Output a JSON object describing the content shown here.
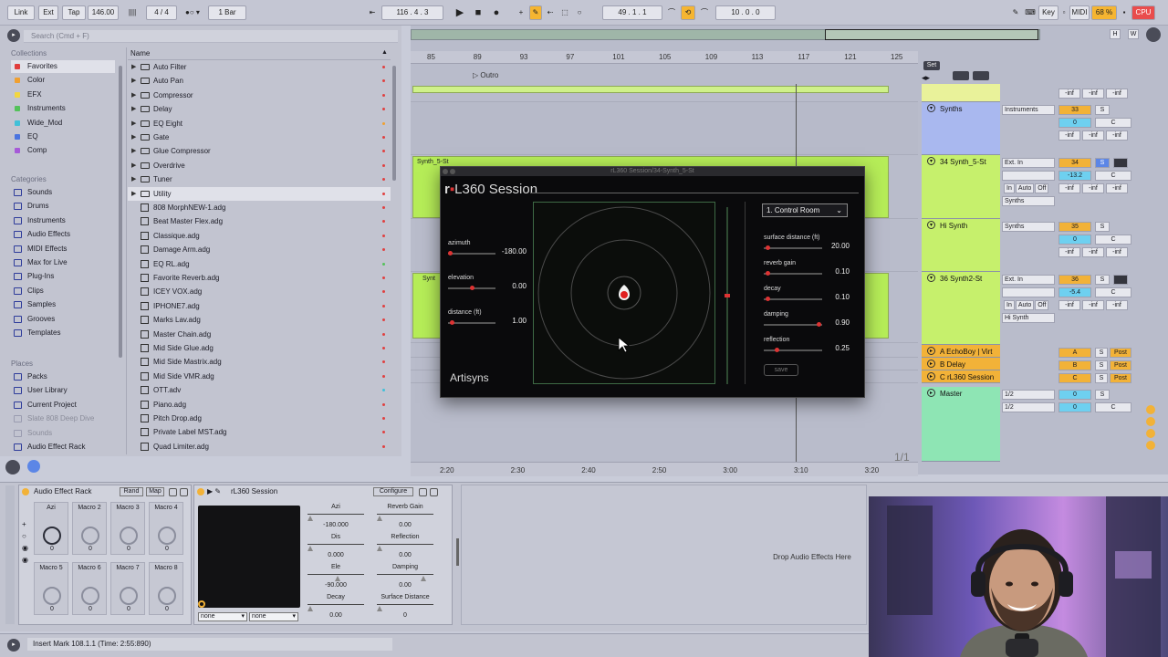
{
  "toolbar": {
    "link": "Link",
    "ext": "Ext",
    "tap": "Tap",
    "tempo": "146.00",
    "time_sig": "4 / 4",
    "quantize": "1 Bar",
    "position": "116 .  4 .  3",
    "loop_start": "49 .  1 .  1",
    "loop_length": "10 .  0 .  0",
    "key": "Key",
    "midi": "MIDI",
    "cpu_percent": "68 %",
    "cpu": "CPU"
  },
  "browser": {
    "search_placeholder": "Search (Cmd + F)",
    "collections_title": "Collections",
    "collections": [
      {
        "label": "Favorites",
        "color": "#e03c3c"
      },
      {
        "label": "Color",
        "color": "#f0a030"
      },
      {
        "label": "EFX",
        "color": "#f2d640"
      },
      {
        "label": "Instruments",
        "color": "#54c25a"
      },
      {
        "label": "Wide_Mod",
        "color": "#40c0d8"
      },
      {
        "label": "EQ",
        "color": "#4a74e0"
      },
      {
        "label": "Comp",
        "color": "#a65ad8"
      }
    ],
    "categories_title": "Categories",
    "categories": [
      "Sounds",
      "Drums",
      "Instruments",
      "Audio Effects",
      "MIDI Effects",
      "Max for Live",
      "Plug-Ins",
      "Clips",
      "Samples",
      "Grooves",
      "Templates"
    ],
    "places_title": "Places",
    "places": [
      "Packs",
      "User Library",
      "Current Project",
      "Slate 808 Deep Dive",
      "Sounds",
      "Audio Effect Rack"
    ],
    "name_header": "Name",
    "folders": [
      "Auto Filter",
      "Auto Pan",
      "Compressor",
      "Delay",
      "EQ Eight",
      "Gate",
      "Glue Compressor",
      "Overdrive",
      "Tuner",
      "Utility"
    ],
    "files": [
      "808 MorphNEW-1.adg",
      "Beat Master Flex.adg",
      "Classique.adg",
      "Damage Arm.adg",
      "EQ RL.adg",
      "Favorite Reverb.adg",
      "ICEY VOX.adg",
      "IPHONE7.adg",
      "Marks Lav.adg",
      "Master Chain.adg",
      "Mid Side Glue.adg",
      "Mid Side Mastrix.adg",
      "Mid Side VMR.adg",
      "OTT.adv",
      "Piano.adg",
      "Pitch Drop.adg",
      "Private Label MST.adg",
      "Quad Limiter.adg"
    ]
  },
  "arrangement": {
    "bars": [
      "85",
      "89",
      "93",
      "97",
      "101",
      "105",
      "109",
      "113",
      "117",
      "121",
      "125"
    ],
    "locator": "Outro",
    "clip_synth": "Synth_5-St",
    "clip_synth2": "Synt",
    "times": [
      "2:20",
      "2:30",
      "2:40",
      "2:50",
      "3:00",
      "3:10",
      "3:20"
    ],
    "page": "1/1",
    "set_label": "Set"
  },
  "tracks": [
    {
      "name": "Synths",
      "color": "#a9b8ef",
      "io": "Instruments",
      "vol": "33",
      "pan": "0",
      "extra": "S"
    },
    {
      "name": "34 Synth_5-St",
      "color": "#c6f06c",
      "io": "Ext. In",
      "vol": "34",
      "pan": "-13.2",
      "out": "Synths"
    },
    {
      "name": "Hi Synth",
      "color": "#c6f06c",
      "io": "Synths",
      "vol": "35",
      "pan": "0"
    },
    {
      "name": "36 Synth2-St",
      "color": "#c6f06c",
      "io": "Ext. In",
      "vol": "36",
      "pan": "-5.4",
      "out": "Hi Synth"
    },
    {
      "name": "A EchoBoy | Virt",
      "color": "#f2b238"
    },
    {
      "name": "B Delay",
      "color": "#f2b238"
    },
    {
      "name": "C rL360 Session",
      "color": "#f2b238"
    },
    {
      "name": "Master",
      "color": "#8ee5b4",
      "io": "1/2",
      "io2": "1/2",
      "vol": "0",
      "pan": "0"
    }
  ],
  "mixer": {
    "inf": "-inf",
    "in": "In",
    "auto": "Auto",
    "off": "Off",
    "post": "Post",
    "c": "C",
    "s": "S"
  },
  "plugin": {
    "window_title": "rL360 Session/34-Synth_5-St",
    "title_prefix": "r",
    "title": "L360 Session",
    "brand": "Artisyns",
    "room": "1. Control Room",
    "save": "save",
    "left_params": [
      {
        "label": "azimuth",
        "value": "-180.00"
      },
      {
        "label": "elevation",
        "value": "0.00"
      },
      {
        "label": "distance (ft)",
        "value": "1.00"
      }
    ],
    "right_params": [
      {
        "label": "surface distance (ft)",
        "value": "20.00"
      },
      {
        "label": "reverb gain",
        "value": "0.10"
      },
      {
        "label": "decay",
        "value": "0.10"
      },
      {
        "label": "damping",
        "value": "0.90"
      },
      {
        "label": "reflection",
        "value": "0.25"
      }
    ]
  },
  "rack": {
    "title": "Audio Effect Rack",
    "rand": "Rand",
    "map": "Map",
    "macros": [
      {
        "label": "Azi",
        "value": "0"
      },
      {
        "label": "Macro 2",
        "value": "0"
      },
      {
        "label": "Macro 3",
        "value": "0"
      },
      {
        "label": "Macro 4",
        "value": "0"
      },
      {
        "label": "Macro 5",
        "value": "0"
      },
      {
        "label": "Macro 6",
        "value": "0"
      },
      {
        "label": "Macro 7",
        "value": "0"
      },
      {
        "label": "Macro 8",
        "value": "0"
      }
    ]
  },
  "device": {
    "title": "rL360 Session",
    "configure": "Configure",
    "left": [
      {
        "label": "Azi",
        "value": "-180.000"
      },
      {
        "label": "Dis",
        "value": "0.000"
      },
      {
        "label": "Ele",
        "value": "-90.000"
      },
      {
        "label": "Decay",
        "value": "0.00"
      }
    ],
    "right": [
      {
        "label": "Reverb Gain",
        "value": "0.00"
      },
      {
        "label": "Reflection",
        "value": "0.00"
      },
      {
        "label": "Damping",
        "value": "0.00"
      },
      {
        "label": "Surface Distance",
        "value": "0"
      }
    ],
    "dd1": "none",
    "dd2": "none"
  },
  "drop_text": "Drop Audio Effects Here",
  "status": "Insert Mark 108.1.1 (Time: 2:55:890)"
}
